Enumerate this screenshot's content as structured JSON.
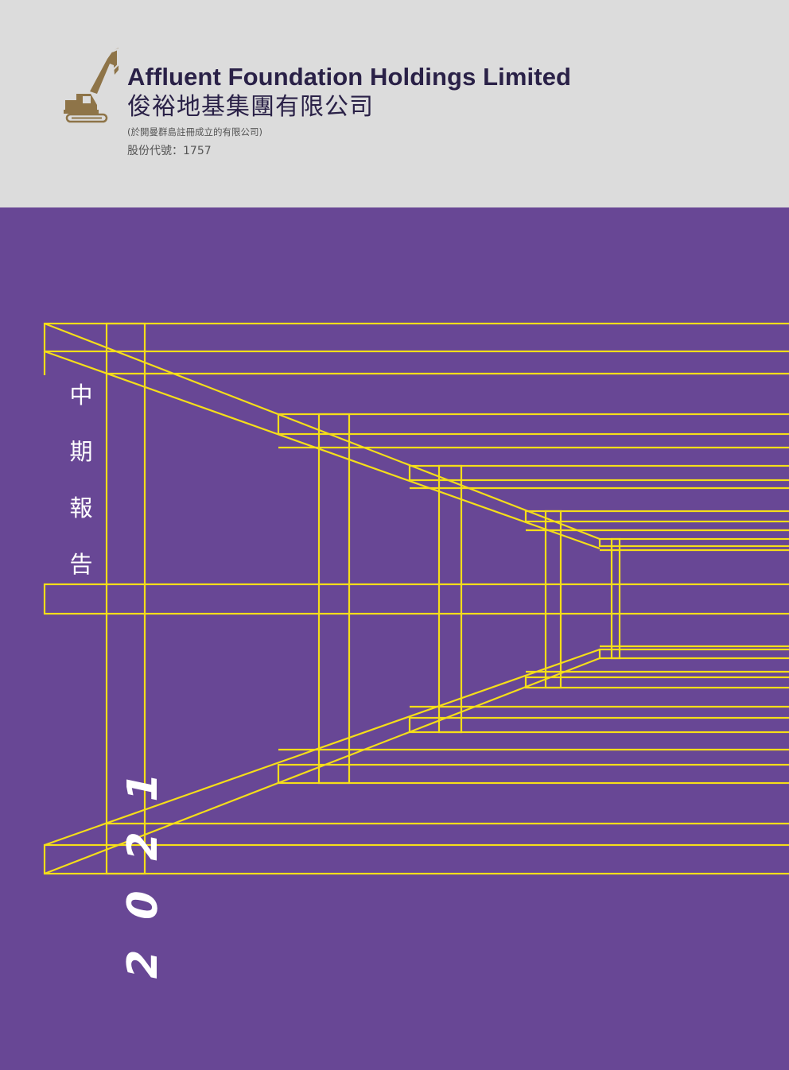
{
  "company": {
    "name_en": "Affluent Foundation Holdings Limited",
    "name_zh": "俊裕地基集團有限公司",
    "incorporation": "(於開曼群島註冊成立的有限公司)",
    "stock_code": "股份代號：1757"
  },
  "report": {
    "title_zh": "中期報告",
    "year": "2021"
  },
  "colors": {
    "header_bg": "#dcdcdc",
    "cover_bg": "#684795",
    "frame_lines": "#f5de19",
    "logo_gold": "#8e7448",
    "company_text": "#2a2147"
  },
  "icons": {
    "logo": "excavator-icon"
  }
}
